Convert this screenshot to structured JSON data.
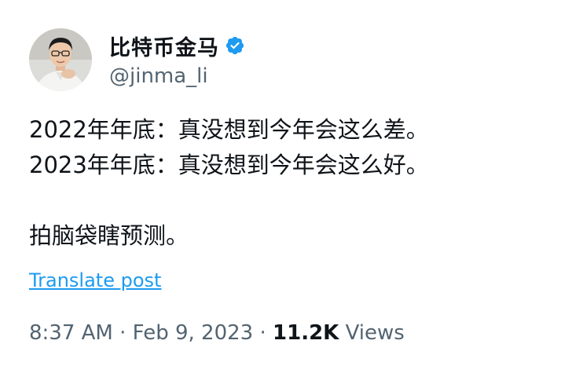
{
  "author": {
    "display_name": "比特币金马",
    "handle": "@jinma_li",
    "avatar_icon": "avatar-photo",
    "verified_icon": "verified-badge-icon",
    "verified_color": "#1d9bf0"
  },
  "tweet": {
    "lines": [
      "2022年年底：真没想到今年会这么差。",
      "2023年年底：真没想到今年会这么好。",
      "",
      "拍脑袋瞎预测。"
    ],
    "translate_label": "Translate post",
    "time": "8:37 AM",
    "separator": " · ",
    "date": "Feb 9, 2023",
    "separator2": " · ",
    "views_count": "11.2K",
    "views_label": " Views"
  },
  "colors": {
    "text": "#0f1419",
    "secondary": "#536471",
    "link": "#1d9bf0"
  }
}
